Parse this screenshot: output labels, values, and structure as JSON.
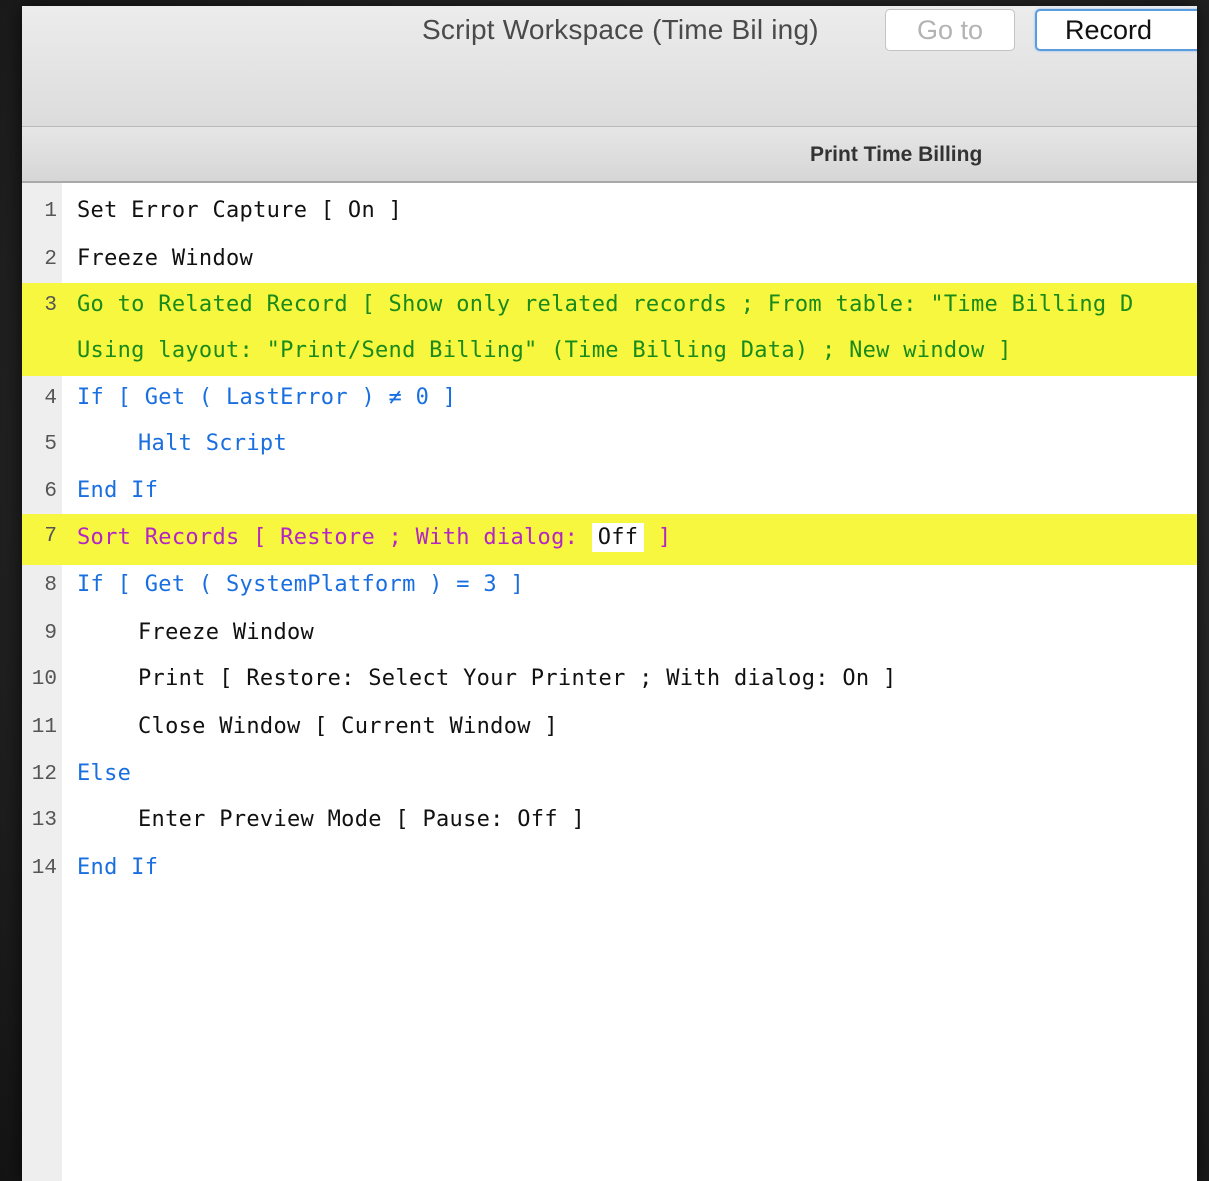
{
  "window": {
    "title": "Script Workspace (Time Bil ing)",
    "goto_label": "Go to",
    "record_label": "Record"
  },
  "tab": {
    "label": "Print Time Billing"
  },
  "script": {
    "lines": [
      {
        "num": "1",
        "text": "Set Error Capture [ On ]"
      },
      {
        "num": "2",
        "text": "Freeze Window"
      },
      {
        "num": "3",
        "text": "Go to Related Record [ Show only related records ; From table: \"Time Billing D"
      },
      {
        "num": "",
        "text": "Using layout: \"Print/Send Billing\" (Time Billing Data) ; New window ]"
      },
      {
        "num": "4",
        "text": "If [ Get ( LastError ) ≠ 0 ]"
      },
      {
        "num": "5",
        "text": "Halt Script"
      },
      {
        "num": "6",
        "text": "End If"
      },
      {
        "num": "7",
        "text_pre": "Sort Records [ Restore ; With dialog: ",
        "text_off": "Off",
        "text_post": " ]"
      },
      {
        "num": "8",
        "text": "If [ Get ( SystemPlatform ) = 3 ]"
      },
      {
        "num": "9",
        "text": "Freeze Window"
      },
      {
        "num": "10",
        "text": "Print [ Restore: Select Your Printer ; With dialog: On ]"
      },
      {
        "num": "11",
        "text": "Close Window [ Current Window ]"
      },
      {
        "num": "12",
        "text": "Else"
      },
      {
        "num": "13",
        "text": "Enter Preview Mode [ Pause: Off ]"
      },
      {
        "num": "14",
        "text": "End If"
      }
    ]
  },
  "colors": {
    "highlight": "#f7f73f",
    "step_black": "#111111",
    "step_green": "#1a8a1a",
    "step_blue": "#1a6fe0",
    "step_purple": "#b425c4"
  }
}
